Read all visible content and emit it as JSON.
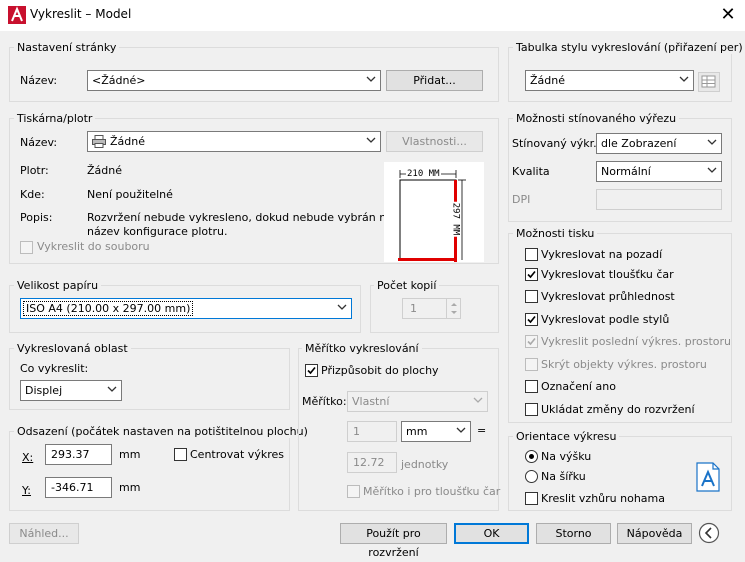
{
  "window": {
    "title": "Vykreslit – Model"
  },
  "page_setup": {
    "legend": "Nastavení stránky",
    "name_label": "Název:",
    "name_value": "<Žádné>",
    "add_button": "Přidat..."
  },
  "printer": {
    "legend": "Tiskárna/plotr",
    "name_label": "Název:",
    "name_value": "Žádné",
    "properties_button": "Vlastnosti...",
    "plotter_label": "Plotr:",
    "plotter_value": "Žádné",
    "where_label": "Kde:",
    "where_value": "Není použitelné",
    "desc_label": "Popis:",
    "desc_value_1": "Rozvržení nebude vykresleno, dokud nebude vybrán nový",
    "desc_value_2": "název konfigurace plotru.",
    "plot_to_file": "Vykreslit do souboru",
    "preview_width": "210 MM",
    "preview_height": "297 MM"
  },
  "paper_size": {
    "legend": "Velikost papíru",
    "value": "ISO A4 (210.00 x 297.00 mm)"
  },
  "copies": {
    "legend": "Počet kopií",
    "value": "1"
  },
  "plot_area": {
    "legend": "Vykreslovaná oblast",
    "what_label": "Co vykreslit:",
    "what_value": "Displej"
  },
  "offset": {
    "legend": "Odsazení (počátek nastaven na potištitelnou plochu)",
    "x_label": "X:",
    "x_value": "293.37",
    "x_unit": "mm",
    "y_label": "Y:",
    "y_value": "-346.71",
    "y_unit": "mm",
    "center_label": "Centrovat výkres"
  },
  "scale": {
    "legend": "Měřítko vykreslování",
    "fit_label": "Přizpůsobit do plochy",
    "scale_label": "Měřítko:",
    "scale_value": "Vlastní",
    "num_value": "1",
    "unit_value": "mm",
    "equals": "=",
    "units_value": "12.72",
    "units_label": "jednotky",
    "lineweights_label": "Měřítko i pro tloušťku čar"
  },
  "style_table": {
    "legend": "Tabulka stylu vykreslování (přiřazení per)",
    "value": "Žádné"
  },
  "shaded": {
    "legend": "Možnosti stínovaného výřezu",
    "shade_label": "Stínovaný výkr.",
    "shade_value": "dle Zobrazení",
    "quality_label": "Kvalita",
    "quality_value": "Normální",
    "dpi_label": "DPI"
  },
  "options": {
    "legend": "Možnosti tisku",
    "items": [
      {
        "label": "Vykreslovat na pozadí"
      },
      {
        "label": "Vykreslovat tloušťku čar"
      },
      {
        "label": "Vykreslovat průhlednost"
      },
      {
        "label": "Vykreslovat podle stylů"
      },
      {
        "label": "Vykreslit poslední výkres. prostoru"
      },
      {
        "label": "Skrýt objekty výkres. prostoru"
      },
      {
        "label": "Označení ano"
      },
      {
        "label": "Ukládat změny do rozvržení"
      }
    ]
  },
  "orientation": {
    "legend": "Orientace výkresu",
    "portrait": "Na výšku",
    "landscape": "Na šířku",
    "upside_down": "Kreslit vzhůru nohama"
  },
  "footer": {
    "preview": "Náhled...",
    "apply": "Použít pro rozvržení",
    "ok": "OK",
    "cancel": "Storno",
    "help": "Nápověda"
  },
  "colors": {
    "accent": "#0078d7",
    "paper_margin": "#e00000"
  }
}
